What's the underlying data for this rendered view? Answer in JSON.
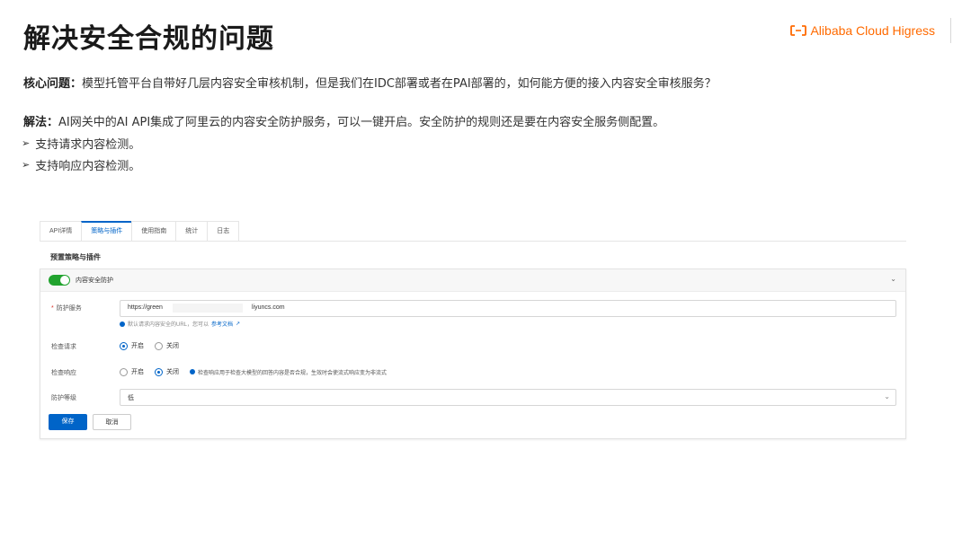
{
  "slide": {
    "title": "解决安全合规的问题",
    "brand": "Alibaba Cloud Higress",
    "core_label": "核心问题：",
    "core_text": "模型托管平台自带好几层内容安全审核机制，但是我们在IDC部署或者在PAI部署的，如何能方便的接入内容安全审核服务？",
    "solution_label": "解法：",
    "solution_text": "AI网关中的AI API集成了阿里云的内容安全防护服务，可以一键开启。安全防护的规则还是要在内容安全服务侧配置。",
    "bullets": [
      "支持请求内容检测。",
      "支持响应内容检测。"
    ]
  },
  "console": {
    "tabs": [
      "API详情",
      "策略与插件",
      "使用指南",
      "统计",
      "日志"
    ],
    "active_tab": "策略与插件",
    "section_title": "预置策略与插件",
    "card": {
      "toggle_label": "内容安全防护",
      "toggle_on": true,
      "service_label": "防护服务",
      "service_value_prefix": "https://green",
      "service_value_suffix": "liyuncs.com",
      "service_hint": "默认请求内容安全的URL，您可以",
      "service_hint_link": "参考文档",
      "check_request_label": "检查请求",
      "check_request_options": [
        "开启",
        "关闭"
      ],
      "check_request_selected": "开启",
      "check_response_label": "检查响应",
      "check_response_options": [
        "开启",
        "关闭"
      ],
      "check_response_selected": "关闭",
      "check_response_hint": "检查响应用于检查大模型的回答内容是否合规，生效时会使流式响应变为非流式",
      "level_label": "防护等级",
      "level_value": "低",
      "save_label": "保存",
      "cancel_label": "取消"
    }
  },
  "colors": {
    "brand": "#ff6a00",
    "primary": "#0064c8",
    "toggle_on": "#21a32e"
  },
  "icons": [
    "alibaba-cloud-logo-icon",
    "chevron-down-icon",
    "info-icon",
    "external-link-icon",
    "arrow-bullet-icon"
  ]
}
